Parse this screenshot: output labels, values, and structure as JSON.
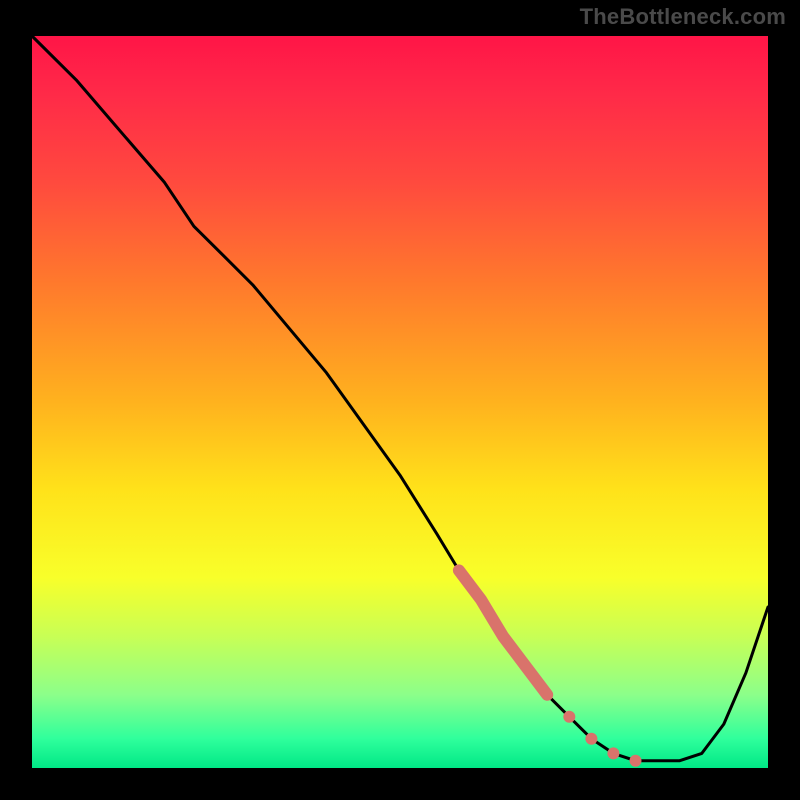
{
  "watermark": {
    "text": "TheBottleneck.com"
  },
  "colors": {
    "frame": "#000000",
    "curve": "#000000",
    "highlight": "#d9736b"
  },
  "chart_data": {
    "type": "line",
    "title": "",
    "xlabel": "",
    "ylabel": "",
    "xlim": [
      0,
      100
    ],
    "ylim": [
      0,
      100
    ],
    "grid": false,
    "legend": false,
    "series": [
      {
        "name": "bottleneck-curve",
        "x": [
          0,
          6,
          12,
          18,
          22,
          26,
          30,
          35,
          40,
          45,
          50,
          55,
          58,
          61,
          64,
          67,
          70,
          73,
          76,
          79,
          82,
          85,
          88,
          91,
          94,
          97,
          100
        ],
        "y": [
          100,
          94,
          87,
          80,
          74,
          70,
          66,
          60,
          54,
          47,
          40,
          32,
          27,
          23,
          18,
          14,
          10,
          7,
          4,
          2,
          1,
          1,
          1,
          2,
          6,
          13,
          22
        ]
      }
    ],
    "highlight_segment": {
      "series": "bottleneck-curve",
      "x_start": 58,
      "x_end": 82,
      "style": "thick-dotted-end",
      "dots_x": [
        73,
        76,
        79,
        82
      ]
    },
    "annotations": [
      {
        "text": "TheBottleneck.com",
        "role": "watermark",
        "position": "top-right"
      }
    ]
  }
}
